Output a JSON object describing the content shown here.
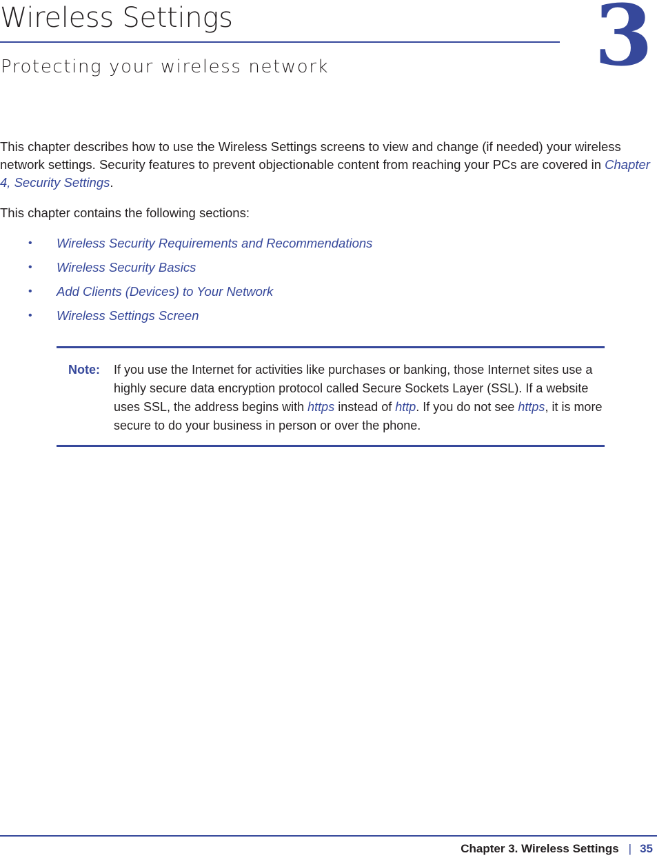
{
  "header": {
    "title": "Wireless Settings",
    "subtitle": "Protecting your wireless network",
    "chapter_number": "3",
    "accent_color": "#36489b"
  },
  "body": {
    "intro_paragraph_part1": "This chapter describes how to use the Wireless Settings screens to view and change (if needed) your wireless network settings. Security features to prevent objectionable content from reaching your PCs are covered in ",
    "intro_link": "Chapter 4, Security Settings",
    "intro_paragraph_part2": ".",
    "sections_lead": "This chapter contains the following sections:",
    "bullet_glyph": "•",
    "sections": [
      "Wireless Security Requirements and Recommendations",
      "Wireless Security Basics",
      "Add Clients (Devices) to Your Network",
      "Wireless Settings Screen"
    ]
  },
  "note": {
    "label": "Note:",
    "text_part1": "If you use the Internet for activities like purchases or banking, those Internet sites use a highly secure data encryption protocol called Secure Sockets Layer (SSL). If a website uses SSL, the address begins with ",
    "term_https_1": "https",
    "text_part2": " instead of ",
    "term_http": "http",
    "text_part3": ". If you do not see ",
    "term_https_2": "https",
    "text_part4": ", it is more secure to do your business in person or over the phone."
  },
  "footer": {
    "chapter_label": "Chapter 3.  Wireless Settings",
    "separator": "|",
    "page_number": "35"
  }
}
